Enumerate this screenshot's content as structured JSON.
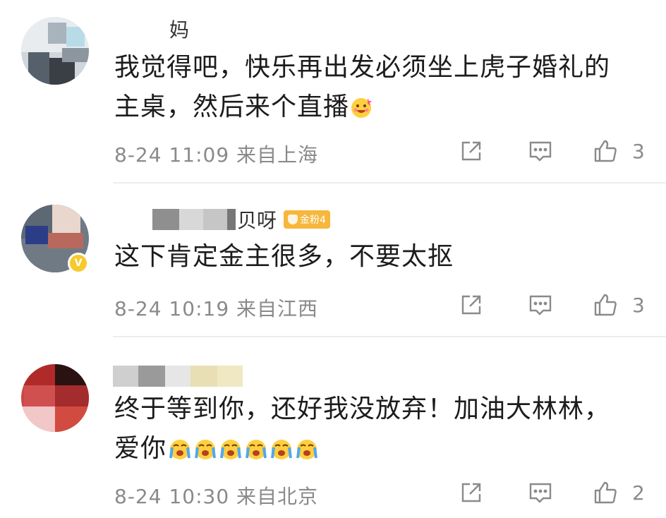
{
  "comments": [
    {
      "name_suffix": "妈",
      "content": "我觉得吧，快乐再出发必须坐上虎子婚礼的主桌，然后来个直播",
      "content_line1": "我觉得吧，快乐再出发必须坐上虎子婚礼的",
      "content_line2": "主桌，然后来个直播",
      "time": "8-24 11:09",
      "location": "来自上海",
      "likes": "3"
    },
    {
      "name_suffix": "贝呀",
      "badge": "金粉4",
      "content": "这下肯定金主很多，不要太抠",
      "time": "8-24 10:19",
      "location": "来自江西",
      "likes": "3"
    },
    {
      "name_suffix": "",
      "content_line1": "终于等到你，还好我没放弃！加油大林林，",
      "content_line2": "爱你",
      "time": "8-24 10:30",
      "location": "来自北京",
      "likes": "2"
    }
  ],
  "icons": {
    "forward": "share-box-icon",
    "reply": "comment-bubble-icon",
    "like": "thumbs-up-icon"
  },
  "colors": {
    "text": "#1c1c1c",
    "meta": "#8a8a8a",
    "badge": "#f6b73c",
    "divider": "#ededed"
  }
}
